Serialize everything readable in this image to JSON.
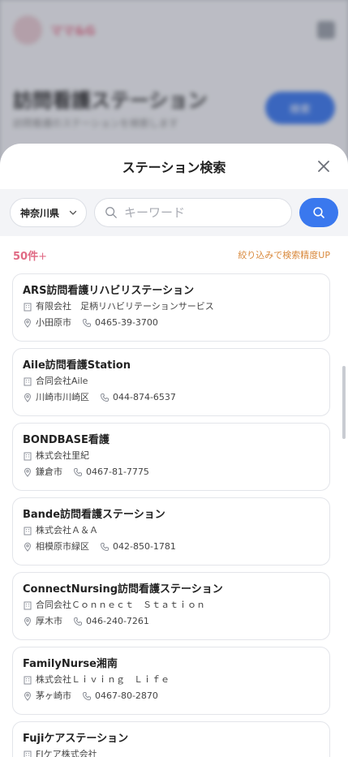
{
  "background": {
    "brand": "ママ&G",
    "title": "訪問看護ステーション",
    "subtitle": "訪問看護のステーションを検索します",
    "action_label": "検索"
  },
  "sheet": {
    "title": "ステーション検索",
    "close_icon": "close-icon"
  },
  "search": {
    "prefecture": "神奈川県",
    "keyword_value": "",
    "keyword_placeholder": "キーワード",
    "button_icon": "search-icon"
  },
  "results": {
    "count": "50件",
    "count_suffix": "+",
    "refine_label": "絞り込みで検索精度UP",
    "items": [
      {
        "name": "ARS訪問看護リハビリステーション",
        "company": "有限会社　足柄リハビリテーションサービス",
        "city": "小田原市",
        "phone": "0465-39-3700"
      },
      {
        "name": "Aile訪問看護Station",
        "company": "合同会社Aile",
        "city": "川崎市川崎区",
        "phone": "044-874-6537"
      },
      {
        "name": "BONDBASE看護",
        "company": "株式会社里紀",
        "city": "鎌倉市",
        "phone": "0467-81-7775"
      },
      {
        "name": "Bande訪問看護ステーション",
        "company": "株式会社Ａ＆Ａ",
        "city": "相模原市緑区",
        "phone": "042-850-1781"
      },
      {
        "name": "ConnectNursing訪問看護ステーション",
        "company": "合同会社Ｃｏｎｎｅｃｔ　Ｓｔａｔｉｏｎ",
        "city": "厚木市",
        "phone": "046-240-7261"
      },
      {
        "name": "FamilyNurse湘南",
        "company": "株式会社Ｌｉｖｉｎｇ　Ｌｉｆｅ",
        "city": "茅ヶ崎市",
        "phone": "0467-80-2870"
      },
      {
        "name": "Fujiケアステーション",
        "company": "FJケア株式会社",
        "city": "",
        "phone": ""
      }
    ]
  },
  "colors": {
    "accent": "#3a78ee",
    "count": "#e06a84",
    "refine": "#d9893c"
  }
}
